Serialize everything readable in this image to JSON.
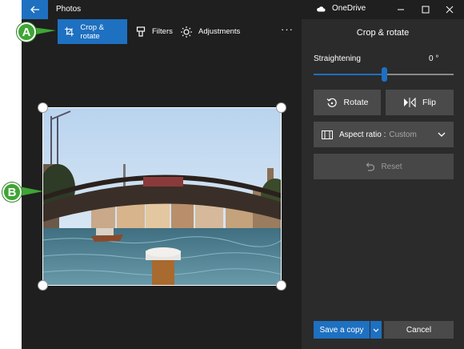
{
  "window": {
    "app_title": "Photos",
    "onedrive_label": "OneDrive"
  },
  "toolbar": {
    "crop_rotate": "Crop & rotate",
    "filters": "Filters",
    "adjustments": "Adjustments",
    "more": "···"
  },
  "panel": {
    "title": "Crop & rotate",
    "straightening_label": "Straightening",
    "straightening_value": "0 °",
    "straightening_level": 0.5,
    "rotate": "Rotate",
    "flip": "Flip",
    "aspect_prefix": "Aspect ratio :",
    "aspect_value": "Custom",
    "reset": "Reset",
    "save_copy": "Save a copy",
    "cancel": "Cancel"
  },
  "callouts": {
    "a": "A",
    "b": "B"
  },
  "colors": {
    "accent": "#1e70c1",
    "background": "#1f1f1f",
    "panel": "#2b2b2b",
    "button": "#4a4a4a",
    "callout": "#3fa535"
  }
}
